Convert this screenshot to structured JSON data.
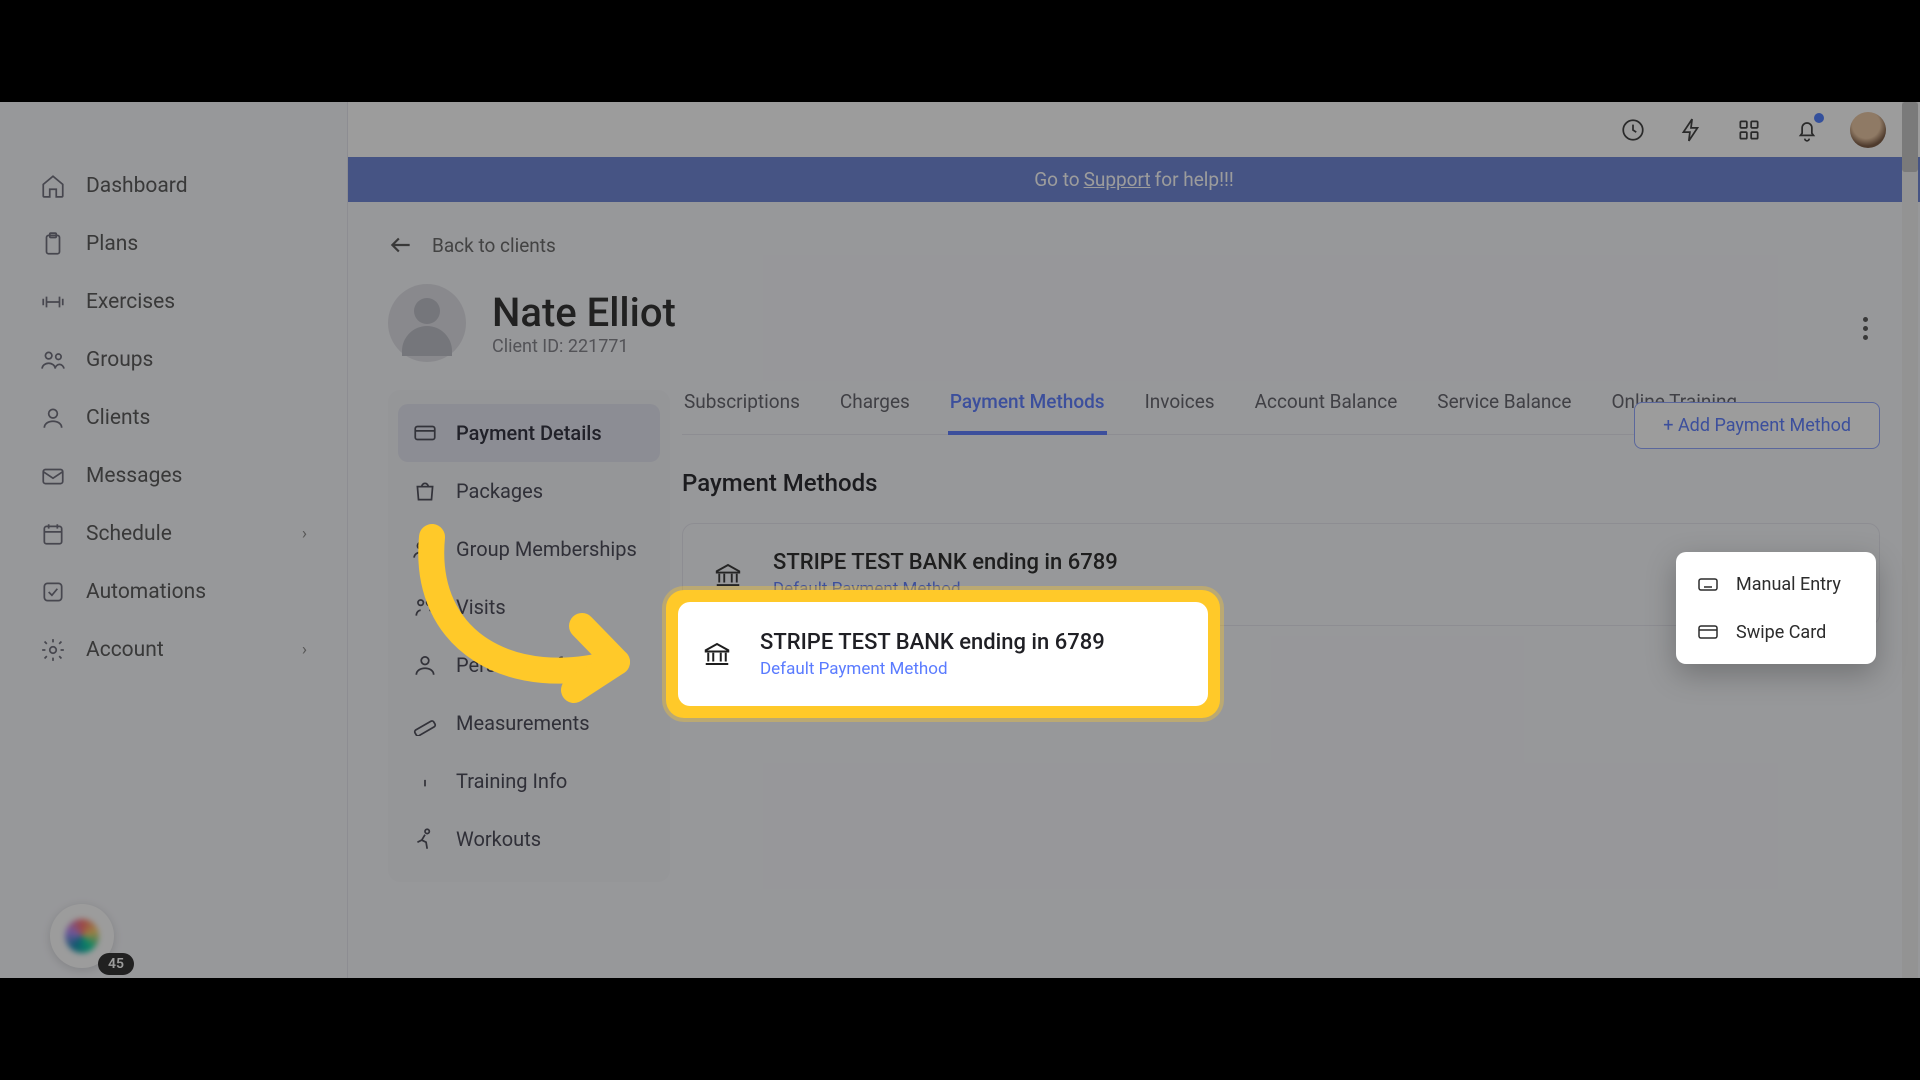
{
  "sidebar": {
    "items": [
      {
        "label": "Dashboard"
      },
      {
        "label": "Plans"
      },
      {
        "label": "Exercises"
      },
      {
        "label": "Groups"
      },
      {
        "label": "Clients"
      },
      {
        "label": "Messages"
      },
      {
        "label": "Schedule"
      },
      {
        "label": "Automations"
      },
      {
        "label": "Account"
      }
    ],
    "help_badge": "45"
  },
  "banner": {
    "prefix": "Go to ",
    "link": "Support",
    "suffix": " for help!!!"
  },
  "back_label": "Back to clients",
  "client": {
    "name": "Nate Elliot",
    "id": "Client ID: 221771"
  },
  "client_menu": [
    "Payment Details",
    "Packages",
    "Group Memberships",
    "Visits",
    "Personal Info",
    "Measurements",
    "Training Info",
    "Workouts"
  ],
  "tabs": [
    "Subscriptions",
    "Charges",
    "Payment Methods",
    "Invoices",
    "Account Balance",
    "Service Balance",
    "Online Training"
  ],
  "section_title": "Payment Methods",
  "add_button": "+ Add Payment Method",
  "payment_method": {
    "title": "STRIPE TEST BANK ending in 6789",
    "subtitle": "Default Payment Method"
  },
  "popover": {
    "manual": "Manual Entry",
    "swipe": "Swipe Card"
  }
}
